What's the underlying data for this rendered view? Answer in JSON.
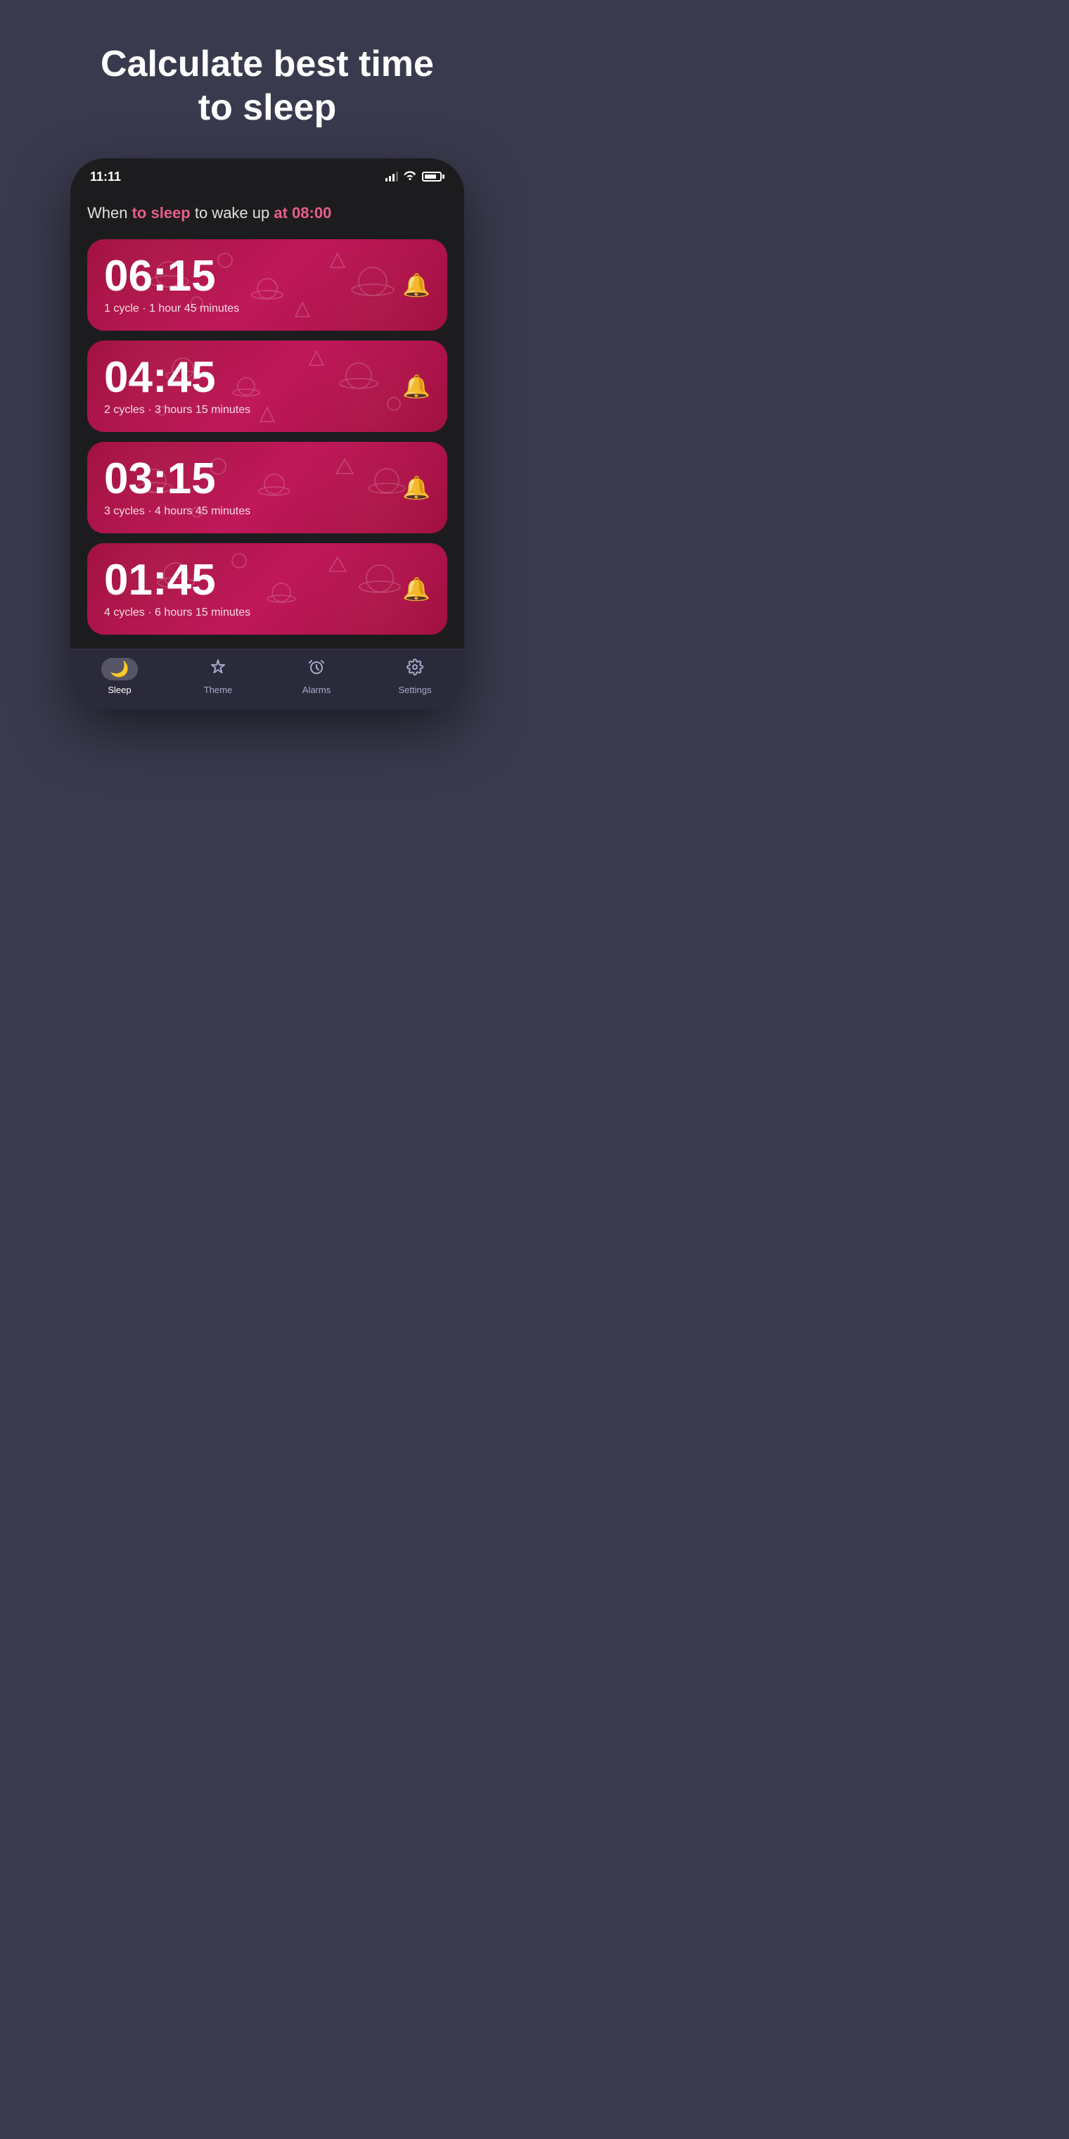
{
  "page": {
    "title": "Calculate best time\nto sleep",
    "background_color": "#3a3a4e"
  },
  "status_bar": {
    "time": "11:11",
    "signal_bars": 3,
    "wifi": true,
    "battery_percent": 80
  },
  "screen": {
    "subtitle_prefix": "When ",
    "subtitle_sleep": "to sleep",
    "subtitle_mid": " to wake up ",
    "subtitle_at": "at 08:00"
  },
  "sleep_cards": [
    {
      "time": "06:15",
      "cycles": "1 cycle · 1 hour 45 minutes",
      "id": "card-1"
    },
    {
      "time": "04:45",
      "cycles": "2 cycles · 3 hours 15 minutes",
      "id": "card-2"
    },
    {
      "time": "03:15",
      "cycles": "3 cycles · 4 hours 45 minutes",
      "id": "card-3"
    },
    {
      "time": "01:45",
      "cycles": "4 cycles · 6 hours 15 minutes",
      "id": "card-4"
    }
  ],
  "nav": {
    "items": [
      {
        "id": "sleep",
        "label": "Sleep",
        "icon": "🌙",
        "active": true
      },
      {
        "id": "theme",
        "label": "Theme",
        "icon": "🎨",
        "active": false
      },
      {
        "id": "alarms",
        "label": "Alarms",
        "icon": "⏰",
        "active": false
      },
      {
        "id": "settings",
        "label": "Settings",
        "icon": "⚙️",
        "active": false
      }
    ]
  }
}
